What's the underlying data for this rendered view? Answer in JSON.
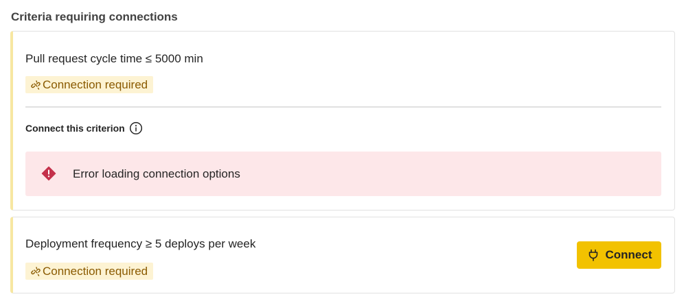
{
  "section": {
    "title": "Criteria requiring connections"
  },
  "criteria": [
    {
      "title": "Pull request cycle time ≤ 5000 min",
      "badge": "Connection required",
      "badge_icon": "link-broken-icon",
      "connect_heading": "Connect this criterion",
      "info_icon": "info-icon",
      "error_message": "Error loading connection options",
      "error_icon": "error-diamond-icon"
    },
    {
      "title": "Deployment frequency ≥ 5 deploys per week",
      "badge": "Connection required",
      "badge_icon": "link-broken-icon",
      "button_label": "Connect",
      "button_icon": "plug-icon"
    }
  ],
  "colors": {
    "accent_border": "#f7e7a1",
    "badge_bg": "#fdf3d3",
    "badge_text": "#8a5a00",
    "error_bg": "#fde7e9",
    "error_icon": "#c4314b",
    "button_bg": "#f2c200"
  }
}
